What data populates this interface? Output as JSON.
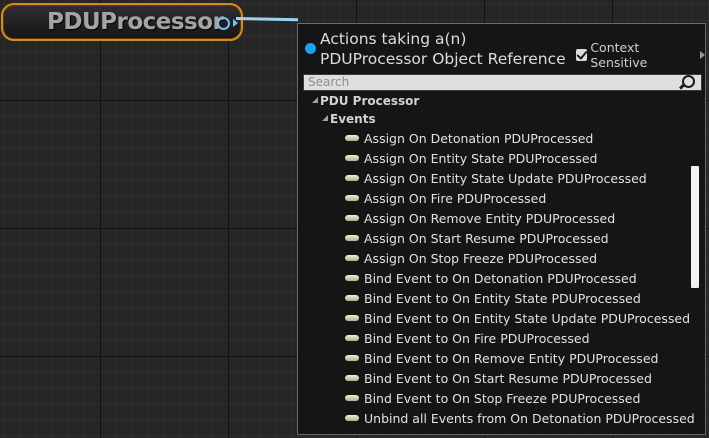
{
  "node": {
    "title": "PDUProcessor"
  },
  "menu": {
    "header_title": "Actions taking a(n) PDUProcessor Object Reference",
    "context_label": "Context Sensitive",
    "search_placeholder": "Search",
    "category": "PDU Processor",
    "subcategory": "Events",
    "items": [
      "Assign On Detonation PDUProcessed",
      "Assign On Entity State PDUProcessed",
      "Assign On Entity State Update PDUProcessed",
      "Assign On Fire PDUProcessed",
      "Assign On Remove Entity PDUProcessed",
      "Assign On Start Resume PDUProcessed",
      "Assign On Stop Freeze PDUProcessed",
      "Bind Event to On Detonation PDUProcessed",
      "Bind Event to On Entity State PDUProcessed",
      "Bind Event to On Entity State Update PDUProcessed",
      "Bind Event to On Fire PDUProcessed",
      "Bind Event to On Remove Entity PDUProcessed",
      "Bind Event to On Start Resume PDUProcessed",
      "Bind Event to On Stop Freeze PDUProcessed",
      "Unbind all Events from On Detonation PDUProcessed"
    ]
  },
  "colors": {
    "node_border": "#d88a1c",
    "pin": "#6cc2f0",
    "header_dot": "#1aa1f0"
  },
  "icons": {
    "pin": "object-pin-circle-icon",
    "event": "event-pill-icon",
    "search": "search-icon",
    "expand": "expanded-triangle-icon"
  }
}
